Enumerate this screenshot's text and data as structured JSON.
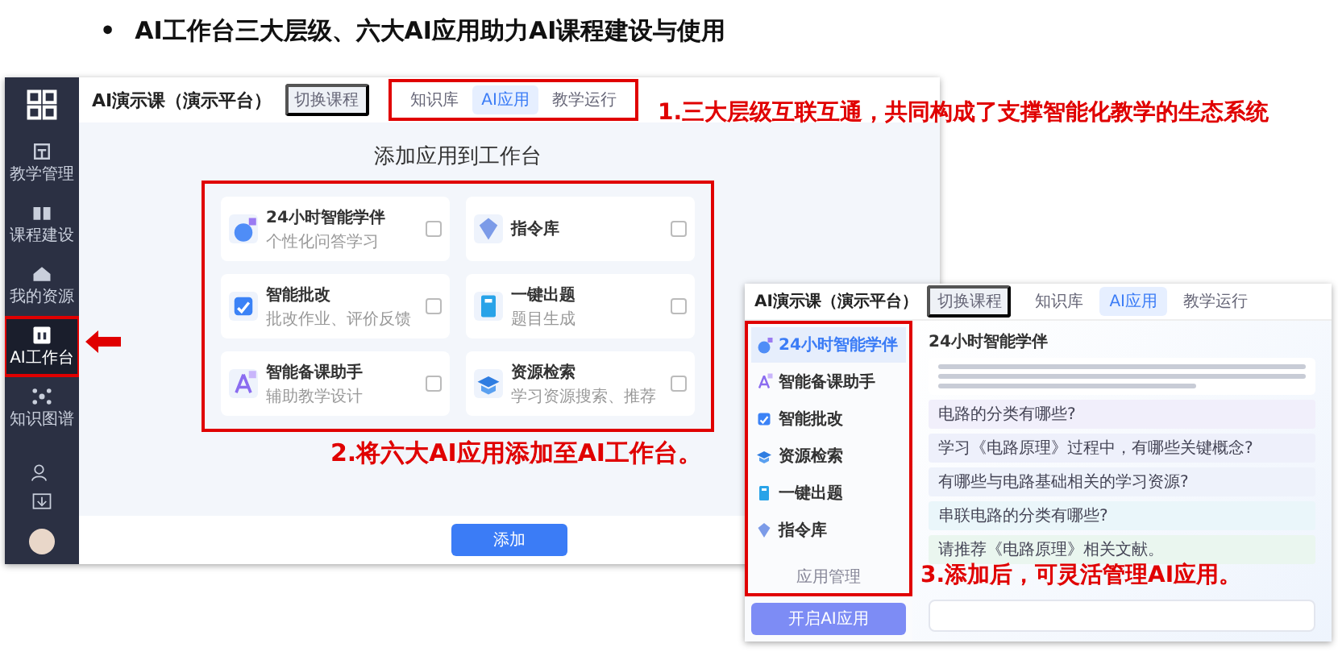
{
  "title": {
    "bullet": "•",
    "text": "AI工作台三大层级、六大AI应用助力AI课程建设与使用"
  },
  "main_window": {
    "course": "AI演示课（演示平台）",
    "switch": "切换课程",
    "sidebar": [
      {
        "label": "教学管理",
        "selected": false
      },
      {
        "label": "课程建设",
        "selected": false
      },
      {
        "label": "我的资源",
        "selected": false
      },
      {
        "label": "AI工作台",
        "selected": true
      },
      {
        "label": "知识图谱",
        "selected": false
      }
    ],
    "tabs": [
      {
        "label": "知识库",
        "selected": false
      },
      {
        "label": "AI应用",
        "selected": true
      },
      {
        "label": "教学运行",
        "selected": false
      }
    ],
    "heading": "添加应用到工作台",
    "apps": [
      {
        "name": "24小时智能学伴",
        "description": "个性化问答学习",
        "checked": false
      },
      {
        "name": "指令库",
        "checked": false
      },
      {
        "name": "智能批改",
        "description": "批改作业、评价反馈",
        "checked": false
      },
      {
        "name": "一键出题",
        "description": "题目生成",
        "checked": false
      },
      {
        "name": "智能备课助手",
        "description": "辅助教学设计",
        "checked": false
      },
      {
        "name": "资源检索",
        "description": "学习资源搜索、推荐",
        "checked": false
      }
    ],
    "add_button": "添加"
  },
  "app_window": {
    "course": "AI演示课（演示平台）",
    "switch": "切换课程",
    "tabs": [
      {
        "label": "知识库",
        "selected": false
      },
      {
        "label": "AI应用",
        "selected": true
      },
      {
        "label": "教学运行",
        "selected": false
      }
    ],
    "apps": [
      {
        "name": "24小时智能学伴",
        "selected": true
      },
      {
        "name": "智能备课助手",
        "selected": false
      },
      {
        "name": "智能批改",
        "selected": false
      },
      {
        "name": "资源检索",
        "selected": false
      },
      {
        "name": "一键出题",
        "selected": false
      },
      {
        "name": "指令库",
        "selected": false
      }
    ],
    "manage": "应用管理",
    "open_button": "开启AI应用",
    "chat_title": "24小时智能学伴",
    "suggestions": [
      {
        "text": "电路的分类有哪些?",
        "color": "#f1effb"
      },
      {
        "text": "学习《电路原理》过程中，有哪些关键概念?",
        "color": "#eef0fb"
      },
      {
        "text": "有哪些与电路基础相关的学习资源?",
        "color": "#eef2fb"
      },
      {
        "text": "串联电路的分类有哪些?",
        "color": "#eaf6fa"
      },
      {
        "text": "请推荐《电路原理》相关文献。",
        "color": "#eaf6ef"
      }
    ]
  },
  "annotations": [
    {
      "text": "1.三大层级互联互通，共同构成了支撑智能化教学的生态系统"
    },
    {
      "text": "2.将六大AI应用添加至AI工作台。"
    },
    {
      "text": "3.添加后，可灵活管理AI应用。"
    }
  ]
}
